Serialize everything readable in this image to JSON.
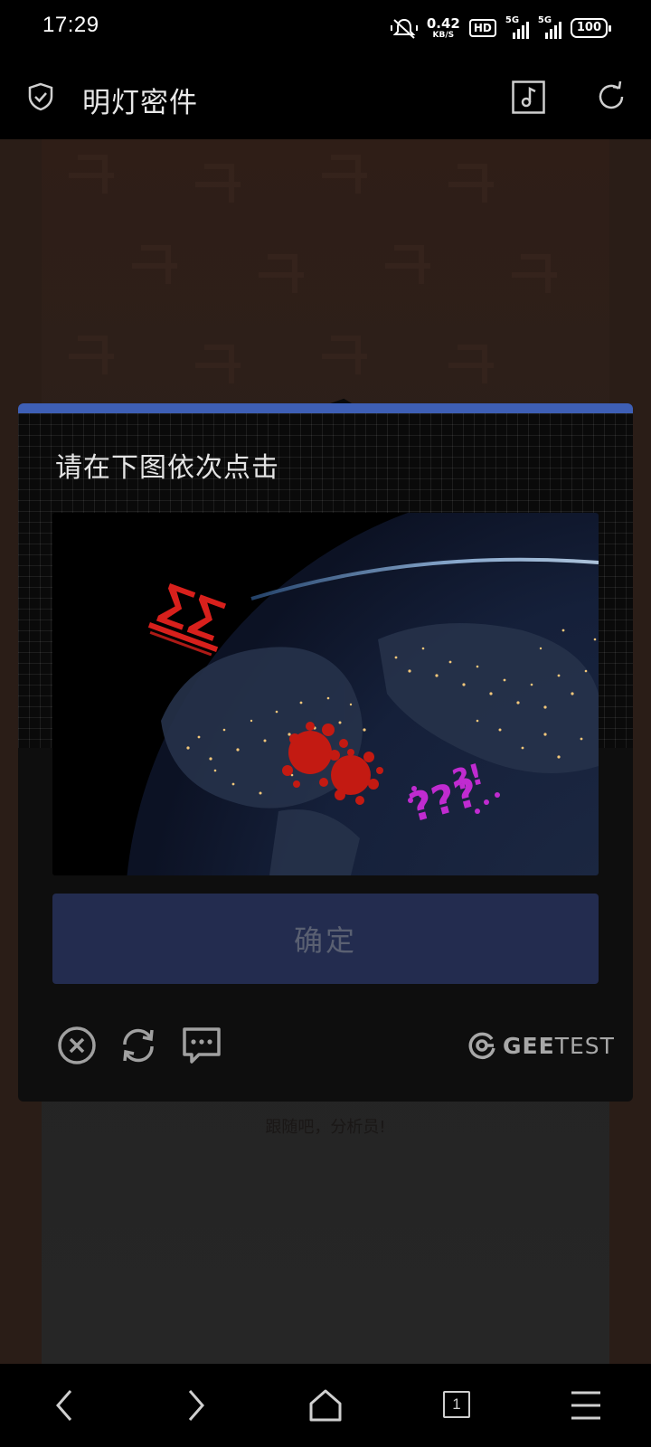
{
  "status_bar": {
    "time": "17:29",
    "net_speed_value": "0.42",
    "net_speed_unit": "KB/S",
    "hd_badge": "HD",
    "signal1_label": "5G",
    "signal2_label": "5G",
    "battery": "100",
    "icons": [
      "mute-vibrate-icon",
      "signal-icon",
      "signal-icon",
      "battery-icon"
    ]
  },
  "header": {
    "title": "明灯密件",
    "icons": [
      "shield-icon",
      "music-note-icon",
      "refresh-icon"
    ]
  },
  "background_page": {
    "hint": "跟随吧，分析员!"
  },
  "captcha": {
    "prompt": "请在下图依次点击",
    "confirm_label": "确定",
    "brand_bold": "GEE",
    "brand_light": "TEST",
    "accent_color": "#3e5fb5",
    "button_color": "#232c4f",
    "icons": [
      "close-icon",
      "reload-icon",
      "feedback-icon",
      "geetest-logo-icon"
    ],
    "target_symbols": [
      "red-sigma-symbols",
      "red-blob-symbols",
      "magenta-question-symbols"
    ]
  },
  "bottom_nav": {
    "tab_count": "1",
    "icons": [
      "back-icon",
      "forward-icon",
      "home-icon",
      "tabs-icon",
      "menu-icon"
    ]
  }
}
